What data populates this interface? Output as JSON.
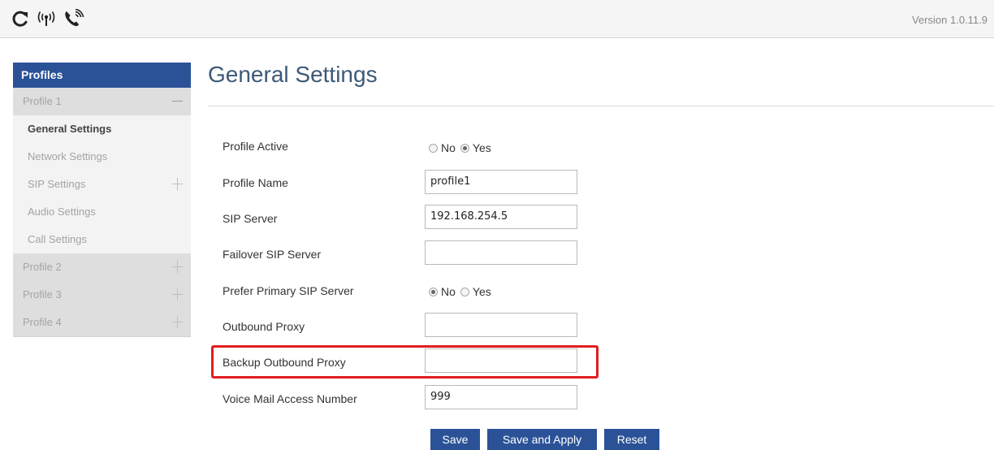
{
  "header": {
    "icons": [
      "refresh-icon",
      "wireless-signal-icon",
      "phone-ringing-icon"
    ],
    "version": "Version 1.0.11.9"
  },
  "sidebar": {
    "title": "Profiles",
    "items": [
      {
        "label": "Profile 1",
        "toggle": "minus"
      },
      {
        "label": "General Settings",
        "active": true
      },
      {
        "label": "Network Settings"
      },
      {
        "label": "SIP Settings",
        "toggle": "plus"
      },
      {
        "label": "Audio Settings"
      },
      {
        "label": "Call Settings"
      },
      {
        "label": "Profile 2",
        "toggle": "plus"
      },
      {
        "label": "Profile 3",
        "toggle": "plus"
      },
      {
        "label": "Profile 4",
        "toggle": "plus"
      }
    ]
  },
  "main": {
    "title": "General Settings",
    "fields": {
      "profile_active": {
        "label": "Profile Active",
        "options": [
          "No",
          "Yes"
        ],
        "selected": "Yes"
      },
      "profile_name": {
        "label": "Profile Name",
        "value": "profile1"
      },
      "sip_server": {
        "label": "SIP Server",
        "value": "192.168.254.5"
      },
      "failover_sip_server": {
        "label": "Failover SIP Server",
        "value": ""
      },
      "prefer_primary": {
        "label": "Prefer Primary SIP Server",
        "options": [
          "No",
          "Yes"
        ],
        "selected": "No"
      },
      "outbound_proxy": {
        "label": "Outbound Proxy",
        "value": ""
      },
      "backup_outbound_proxy": {
        "label": "Backup Outbound Proxy",
        "value": ""
      },
      "voice_mail": {
        "label": "Voice Mail Access Number",
        "value": "999"
      }
    },
    "buttons": {
      "save": "Save",
      "save_apply": "Save and Apply",
      "reset": "Reset"
    }
  },
  "colors": {
    "accent": "#2b5297",
    "highlight": "#e01e1e",
    "title": "#3d5977"
  }
}
